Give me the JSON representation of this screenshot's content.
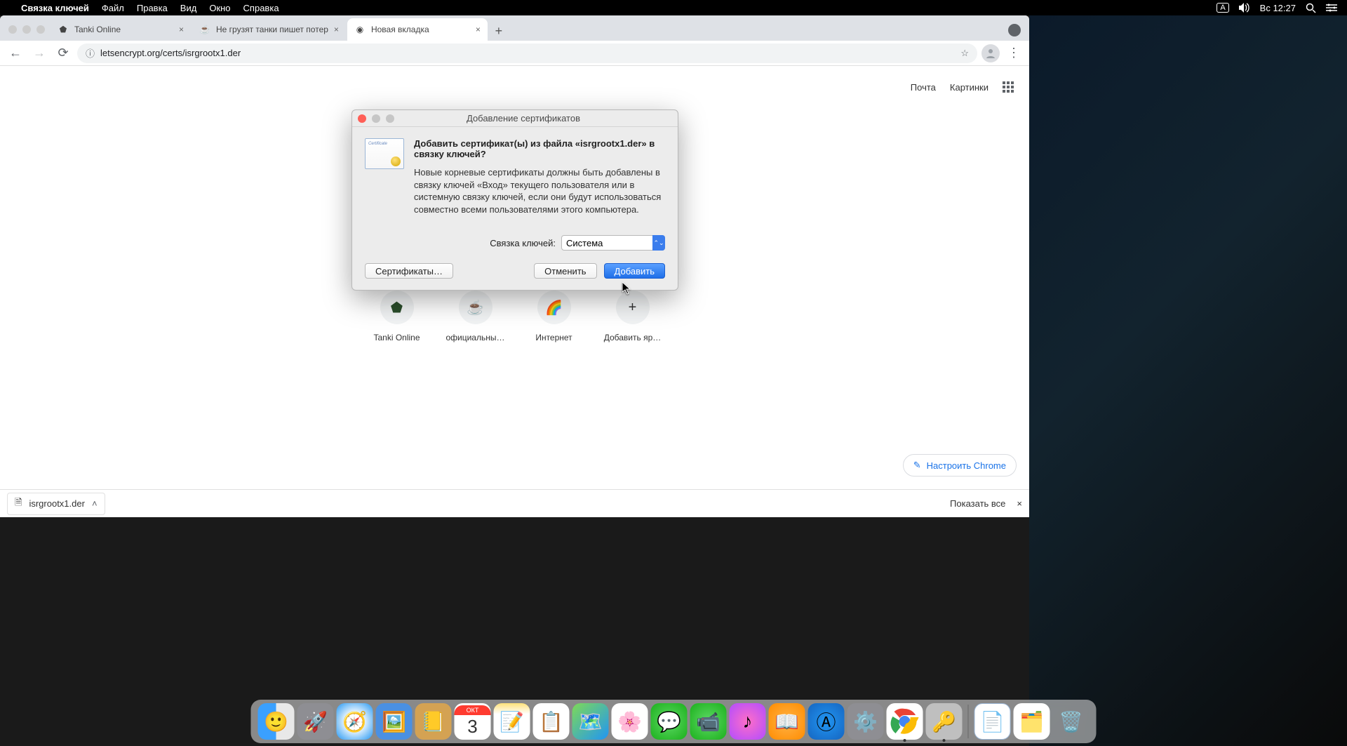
{
  "menubar": {
    "app_name": "Связка ключей",
    "items": [
      "Файл",
      "Правка",
      "Вид",
      "Окно",
      "Справка"
    ],
    "lang": "A",
    "clock": "Вс 12:27"
  },
  "chrome": {
    "tabs": [
      {
        "title": "Tanki Online",
        "active": false
      },
      {
        "title": "Не грузят танки пишет потер",
        "active": false
      },
      {
        "title": "Новая вкладка",
        "active": true
      }
    ],
    "omnibox": "letsencrypt.org/certs/isrgrootx1.der",
    "top_links": {
      "mail": "Почта",
      "images": "Картинки"
    },
    "shortcuts": [
      {
        "label": "Tanki Online"
      },
      {
        "label": "официальны…"
      },
      {
        "label": "Интернет"
      },
      {
        "label": "Добавить яр…"
      }
    ],
    "customize": "Настроить Chrome",
    "downloads": {
      "file": "isrgrootx1.der",
      "show_all": "Показать все"
    }
  },
  "modal": {
    "title": "Добавление сертификатов",
    "heading": "Добавить сертификат(ы) из файла «isrgrootx1.der» в связку ключей?",
    "description": "Новые корневые сертификаты должны быть добавлены в связку ключей «Вход» текущего пользователя или в системную связку ключей, если они будут использоваться совместно всеми пользователями этого компьютера.",
    "keychain_label": "Связка ключей:",
    "keychain_value": "Система",
    "certificates_btn": "Сертификаты…",
    "cancel_btn": "Отменить",
    "add_btn": "Добавить"
  },
  "dock": {
    "apps": [
      "finder",
      "launchpad",
      "safari",
      "preview",
      "contacts",
      "calendar",
      "notes",
      "reminders",
      "photos-app",
      "photos",
      "messages",
      "facetime",
      "itunes",
      "ibooks",
      "appstore",
      "settings",
      "chrome",
      "keychain"
    ],
    "calendar_month": "ОКТ",
    "calendar_day": "3"
  }
}
